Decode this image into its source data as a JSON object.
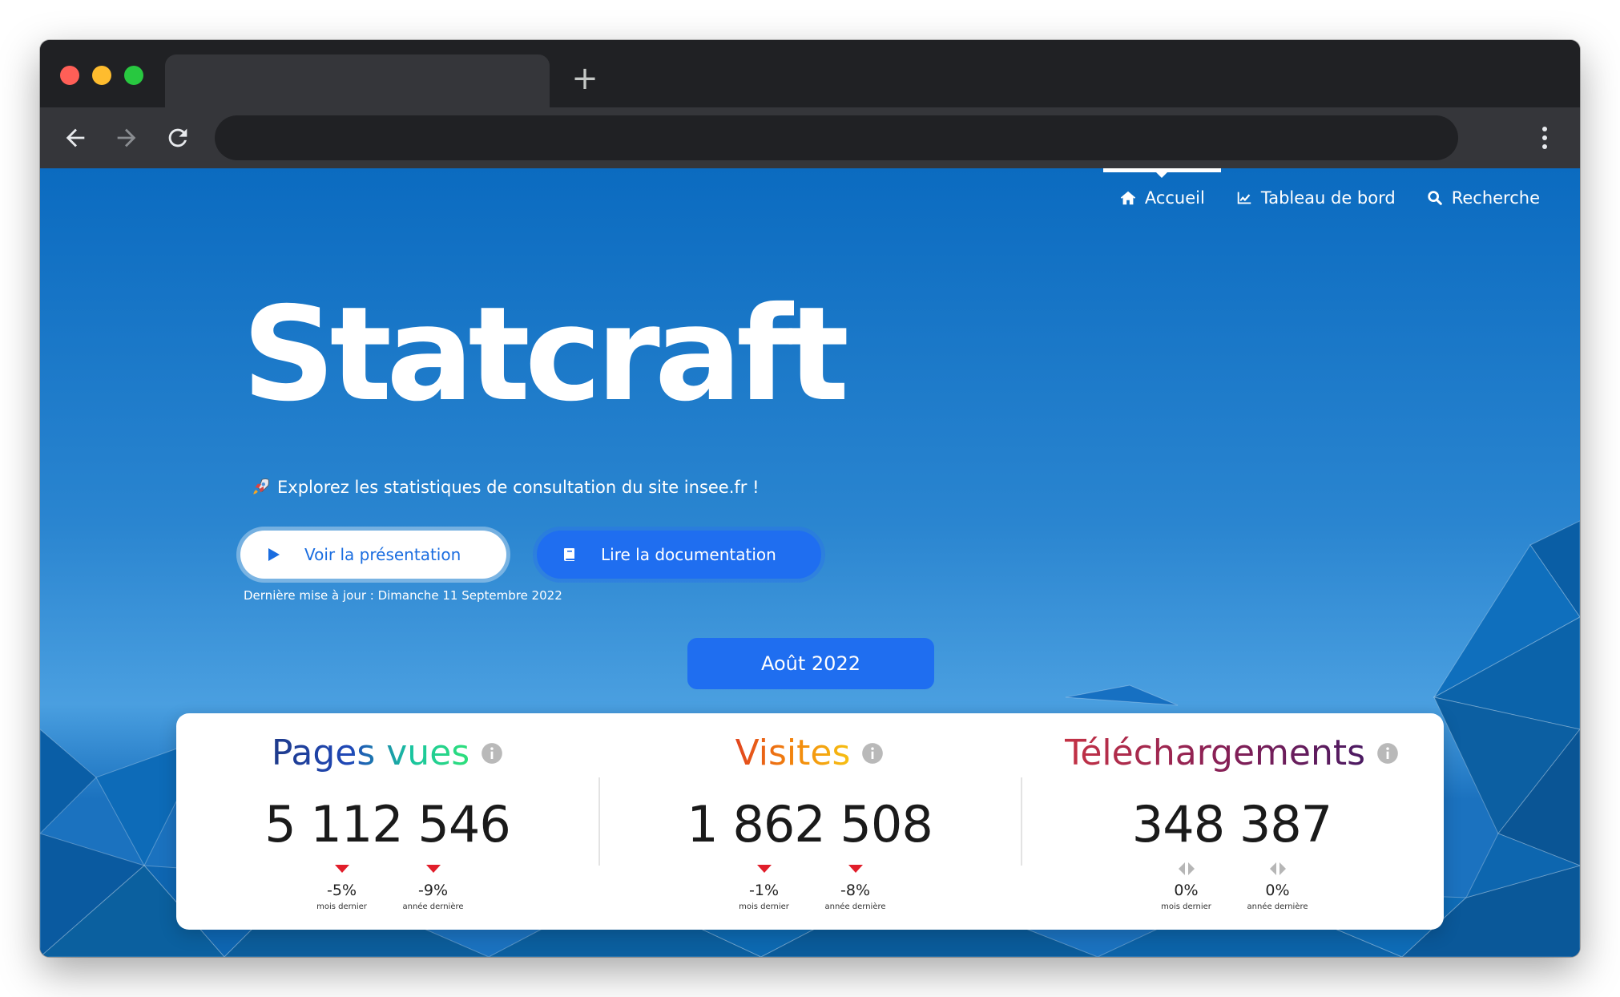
{
  "browser": {
    "new_tab_glyph": "+",
    "address": ""
  },
  "nav": {
    "items": [
      {
        "label": "Accueil",
        "icon": "home-icon",
        "active": true
      },
      {
        "label": "Tableau de bord",
        "icon": "chart-line-icon",
        "active": false
      },
      {
        "label": "Recherche",
        "icon": "search-icon",
        "active": false
      }
    ]
  },
  "hero": {
    "title": "Statcraft",
    "tagline": "Explorez les statistiques de consultation du site insee.fr !",
    "tagline_icon": "rocket-icon",
    "primary_button": "Voir la présentation",
    "primary_icon": "play-icon",
    "secondary_button": "Lire la documentation",
    "secondary_icon": "book-icon",
    "last_update": "Dernière mise à jour : Dimanche 11 Septembre 2022"
  },
  "period": "Août 2022",
  "stats": [
    {
      "title_part1": "Pages",
      "title_part2": "vues",
      "value": "5 112 546",
      "month_delta": "-5%",
      "month_label": "mois dernier",
      "month_trend": "down",
      "year_delta": "-9%",
      "year_label": "année dernière",
      "year_trend": "down"
    },
    {
      "title": "Visites",
      "value": "1 862 508",
      "month_delta": "-1%",
      "month_label": "mois dernier",
      "month_trend": "down",
      "year_delta": "-8%",
      "year_label": "année dernière",
      "year_trend": "down"
    },
    {
      "title": "Téléchargements",
      "value": "348 387",
      "month_delta": "0%",
      "month_label": "mois dernier",
      "month_trend": "flat",
      "year_delta": "0%",
      "year_label": "année dernière",
      "year_trend": "flat"
    }
  ],
  "colors": {
    "page_bg_top": "#0b6bc0",
    "accent_blue": "#1f6ef0",
    "trend_down": "#e11d2a",
    "trend_flat": "#b6b6b6"
  }
}
